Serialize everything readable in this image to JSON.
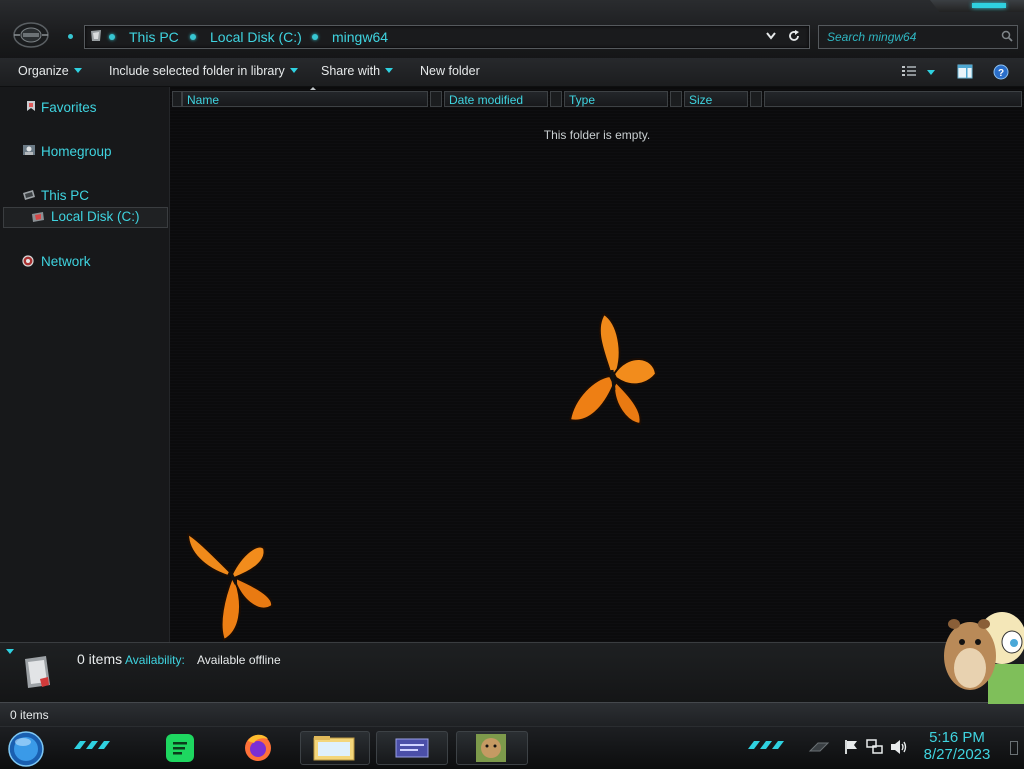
{
  "address": {
    "crumbs": [
      "This PC",
      "Local Disk (C:)",
      "mingw64"
    ]
  },
  "search": {
    "placeholder": "Search mingw64"
  },
  "toolbar": {
    "organize": "Organize",
    "include_library": "Include selected folder in library",
    "share_with": "Share with",
    "new_folder": "New folder"
  },
  "nav": {
    "favorites": "Favorites",
    "homegroup": "Homegroup",
    "this_pc": "This PC",
    "local_disk": "Local Disk (C:)",
    "network": "Network"
  },
  "columns": [
    "Name",
    "Date modified",
    "Type",
    "Size"
  ],
  "content": {
    "empty_message": "This folder is empty."
  },
  "details": {
    "count": "0 items",
    "availability_label": "Availability:",
    "availability_value": "Available offline"
  },
  "status": {
    "count": "0 items"
  },
  "clock": {
    "time": "5:16 PM",
    "date": "8/27/2023"
  },
  "colors": {
    "accent": "#3fd4e0",
    "background": "#0a0a0b"
  }
}
